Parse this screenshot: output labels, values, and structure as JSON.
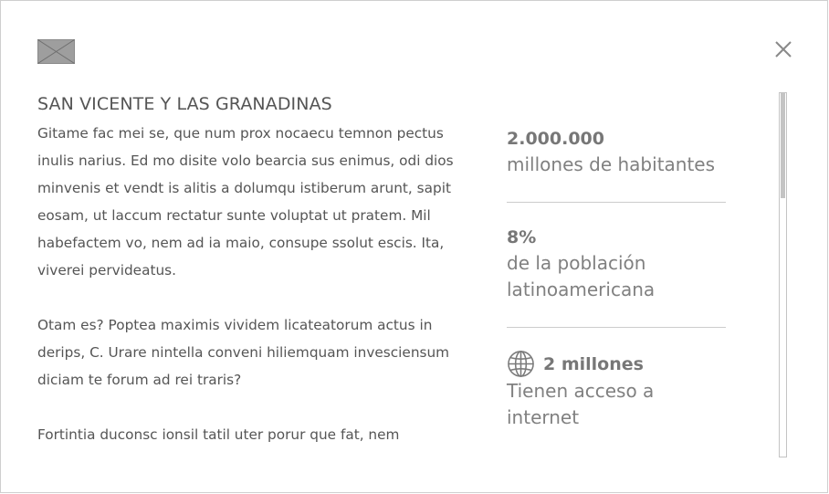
{
  "modal": {
    "flag_icon": "flag-placeholder-icon",
    "close_icon": "close-icon",
    "title": "SAN VICENTE Y LAS GRANADINAS",
    "paragraphs": [
      "Gitame fac mei se, que num prox nocaecu temnon pectus inulis narius.  Ed mo disite volo bearcia sus enimus, odi dios minvenis et vendt is alitis a dolumqu istiberum arunt, sapit eosam, ut laccum rectatur sunte voluptat ut pratem. Mil habefactem vo, nem ad ia maio, consupe ssolut escis. Ita, viverei pervideatus.",
      "Otam es? Poptea maximis vividem licateatorum actus in derips, C. Urare nintella conveni hiliemquam invesciensum diciam te forum ad rei traris?",
      "Fortintia duconsc ionsil tatil uter porur que fat, nem"
    ],
    "stats": [
      {
        "value": "2.000.000",
        "label": "millones de habitantes"
      },
      {
        "value": "8%",
        "label": "de la población latinoamericana"
      },
      {
        "value": "2 millones",
        "label": "Tienen acceso a internet",
        "icon": "globe-icon"
      }
    ],
    "scroll_position": 0.0
  }
}
